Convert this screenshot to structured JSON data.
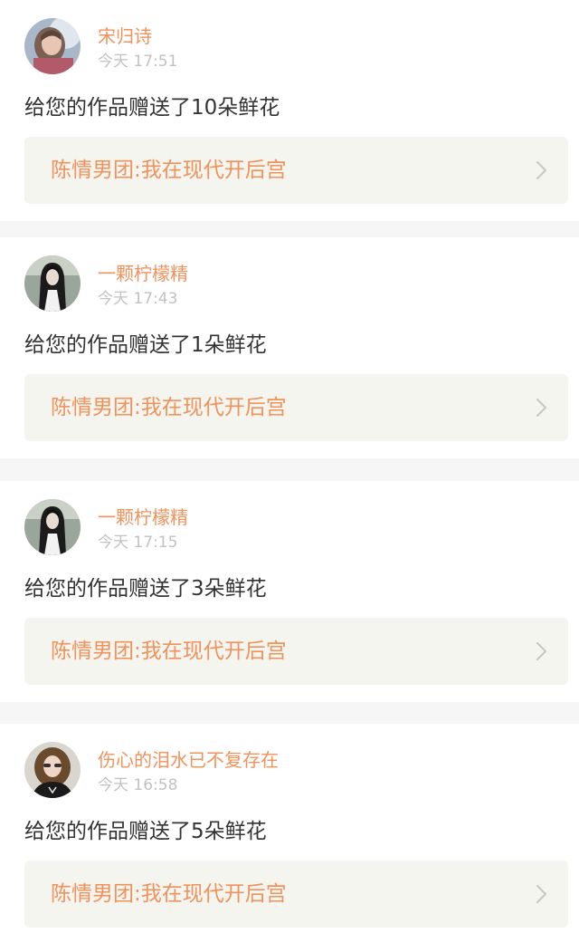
{
  "notifications": [
    {
      "username": "宋归诗",
      "time": "今天 17:51",
      "message": "给您的作品赠送了10朵鲜花",
      "work_title": "陈情男团:我在现代开后宫",
      "avatar": "girl-blurred-avatar"
    },
    {
      "username": "一颗柠檬精",
      "time": "今天 17:43",
      "message": "给您的作品赠送了1朵鲜花",
      "work_title": "陈情男团:我在现代开后宫",
      "avatar": "long-black-hair-avatar"
    },
    {
      "username": "一颗柠檬精",
      "time": "今天 17:15",
      "message": "给您的作品赠送了3朵鲜花",
      "work_title": "陈情男团:我在现代开后宫",
      "avatar": "long-black-hair-avatar"
    },
    {
      "username": "伤心的泪水已不复存在",
      "time": "今天 16:58",
      "message": "给您的作品赠送了5朵鲜花",
      "work_title": "陈情男团:我在现代开后宫",
      "avatar": "curly-hair-girl-avatar"
    }
  ],
  "colors": {
    "accent": "#f0925c",
    "time_gray": "#c2c2c2",
    "text": "#333333",
    "link_bg": "#f5f5f0",
    "divider_bg": "#f6f6f6"
  },
  "icons": {
    "link_arrow": "chevron-right-icon"
  }
}
